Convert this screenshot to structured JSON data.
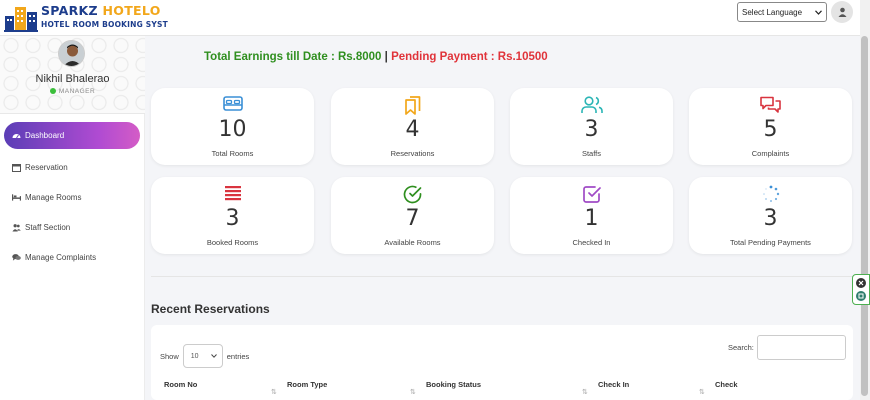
{
  "brand": {
    "title": "SPARKZ ",
    "title_accent": "HOTELO",
    "subtitle": "HOTEL ROOM BOOKING SYST"
  },
  "header": {
    "language_select": "Select Language"
  },
  "profile": {
    "name": "Nikhil Bhalerao",
    "role": "MANAGER"
  },
  "sidebar": {
    "items": [
      {
        "label": "Dashboard",
        "icon": "dashboard-gauge-icon"
      },
      {
        "label": "Reservation",
        "icon": "calendar-icon"
      },
      {
        "label": "Manage Rooms",
        "icon": "bed-icon"
      },
      {
        "label": "Staff Section",
        "icon": "users-icon"
      },
      {
        "label": "Manage Complaints",
        "icon": "comments-icon"
      }
    ]
  },
  "earnings": {
    "total": "Total Earnings till Date : Rs.8000",
    "separator": " | ",
    "pending": "Pending Payment : Rs.10500"
  },
  "cards": [
    {
      "value": "10",
      "label": "Total Rooms",
      "icon": "bed-icon",
      "color": "#3a8fd6"
    },
    {
      "value": "4",
      "label": "Reservations",
      "icon": "bookmarks-icon",
      "color": "#f2a71b"
    },
    {
      "value": "3",
      "label": "Staffs",
      "icon": "users-icon",
      "color": "#2ab5b5"
    },
    {
      "value": "5",
      "label": "Complaints",
      "icon": "chat-bubbles-icon",
      "color": "#d9343f"
    },
    {
      "value": "3",
      "label": "Booked Rooms",
      "icon": "list-lines-icon",
      "color": "#d9343f"
    },
    {
      "value": "7",
      "label": "Available Rooms",
      "icon": "check-circle-icon",
      "color": "#2f8f1f"
    },
    {
      "value": "1",
      "label": "Checked In",
      "icon": "check-square-icon",
      "color": "#a04bc6"
    },
    {
      "value": "3",
      "label": "Total Pending Payments",
      "icon": "spinner-icon",
      "color": "#3a8fd6"
    }
  ],
  "recent": {
    "title": "Recent Reservations",
    "show_label": "Show",
    "entries_value": "10",
    "entries_label": "entries",
    "search_label": "Search:",
    "columns": [
      "Room No",
      "Room Type",
      "Booking Status",
      "Check In",
      "Check"
    ]
  }
}
